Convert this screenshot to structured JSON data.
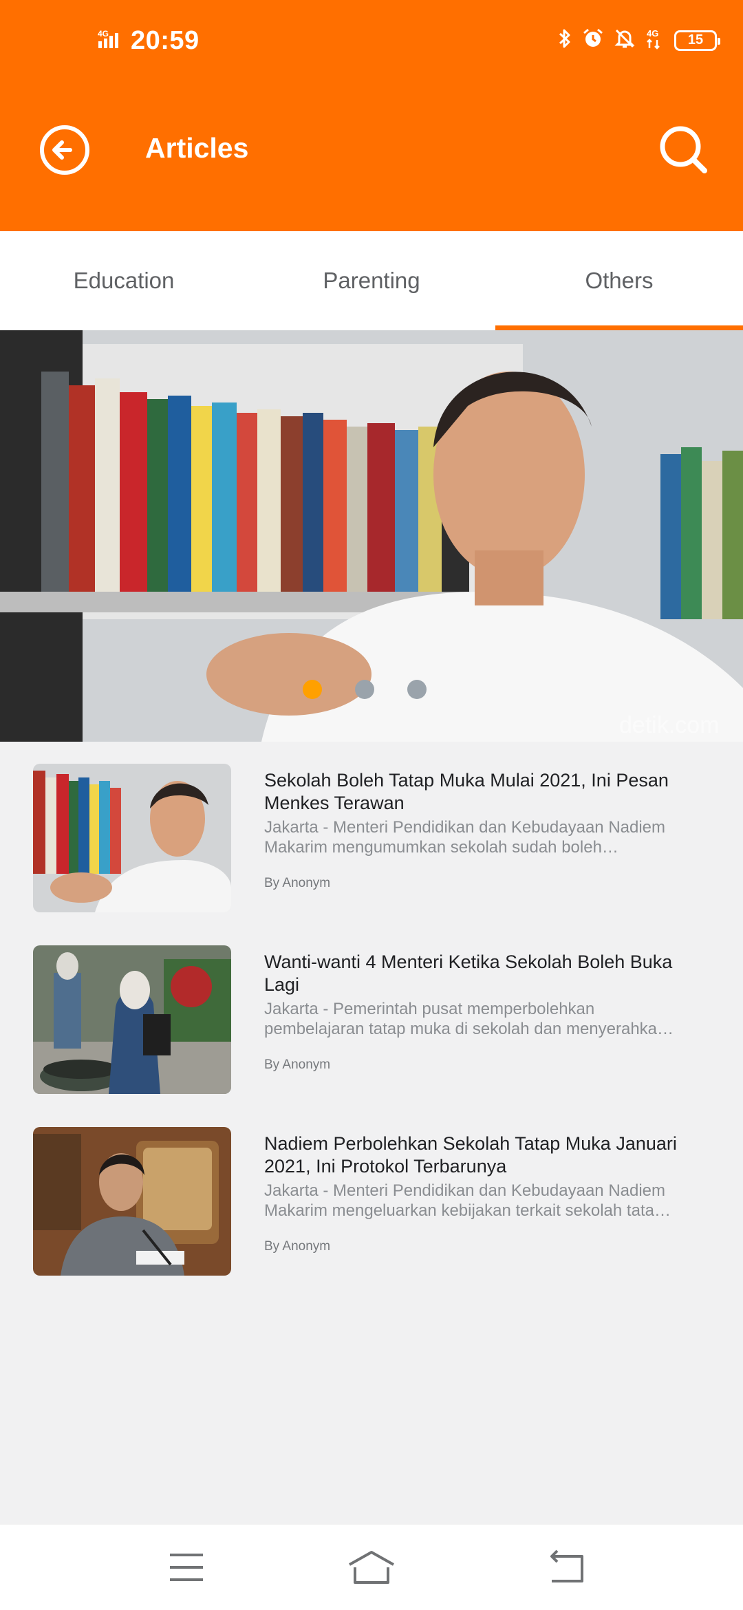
{
  "status_bar": {
    "time": "20:59",
    "network_label": "4G",
    "network_label_right": "4G",
    "battery": "15",
    "icons": [
      "signal-icon",
      "bluetooth-icon",
      "alarm-icon",
      "mute-icon",
      "network-icon",
      "battery-icon"
    ]
  },
  "app_bar": {
    "title": "Articles",
    "back_icon": "back-arrow-icon",
    "search_icon": "search-icon"
  },
  "tabs": [
    {
      "label": "Education",
      "active": false
    },
    {
      "label": "Parenting",
      "active": false
    },
    {
      "label": "Others",
      "active": true
    }
  ],
  "banner": {
    "slide_count": 3,
    "active_slide": 1,
    "watermark": "detik.com"
  },
  "articles": [
    {
      "title": "Sekolah Boleh Tatap Muka Mulai 2021, Ini Pesan Menkes Terawan",
      "snippet": "Jakarta - Menteri Pendidikan dan Kebudayaan Nadiem Makarim mengumumkan sekolah sudah boleh menyelenggarakan pembelajaran tatap muka",
      "author": "By Anonym"
    },
    {
      "title": "Wanti-wanti 4 Menteri Ketika Sekolah Boleh Buka Lagi",
      "snippet": "Jakarta - Pemerintah pusat memperbolehkan pembelajaran tatap muka di sekolah dan menyerahkan keputusan kepada daerah",
      "author": "By Anonym"
    },
    {
      "title": "Nadiem Perbolehkan Sekolah Tatap Muka Januari 2021, Ini Protokol Terbarunya",
      "snippet": "Jakarta - Menteri Pendidikan dan Kebudayaan Nadiem Makarim mengeluarkan kebijakan terkait sekolah tatap muka",
      "author": "By Anonym"
    }
  ],
  "nav_bar": {
    "icons": [
      "menu-icon",
      "home-icon",
      "back-icon"
    ]
  },
  "colors": {
    "accent": "#ff6f00",
    "dot_active": "#ffa000",
    "dot_inactive": "#9aa3ab",
    "background": "#f1f1f2"
  }
}
